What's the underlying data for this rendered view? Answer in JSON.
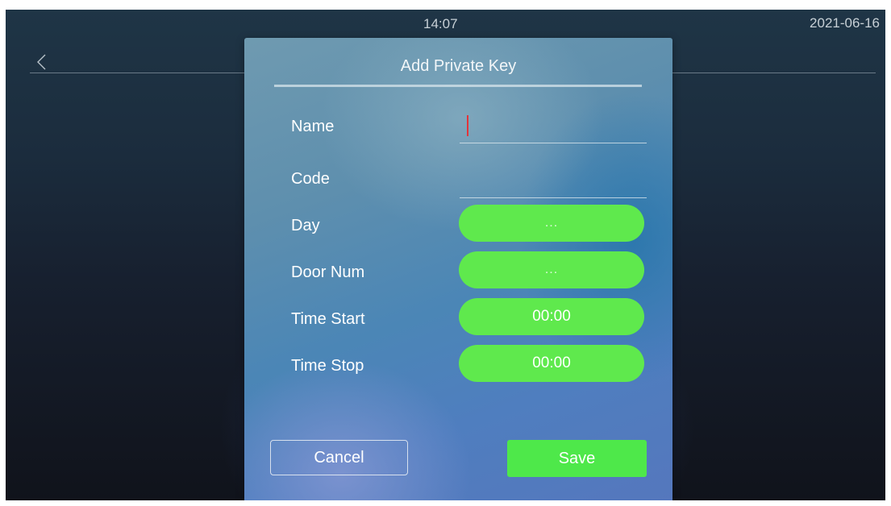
{
  "status_bar": {
    "time": "14:07",
    "date": "2021-06-16"
  },
  "dialog": {
    "title": "Add Private Key",
    "fields": {
      "name": {
        "label": "Name",
        "value": ""
      },
      "code": {
        "label": "Code",
        "value": ""
      },
      "day": {
        "label": "Day",
        "value": "..."
      },
      "door_num": {
        "label": "Door Num",
        "value": "..."
      },
      "time_start": {
        "label": "Time Start",
        "value": "00:00"
      },
      "time_stop": {
        "label": "Time Stop",
        "value": "00:00"
      }
    },
    "buttons": {
      "cancel": "Cancel",
      "save": "Save"
    }
  },
  "colors": {
    "green_button": "#5fe94d",
    "save_button": "#4ee84a",
    "text_cursor": "#e2343a",
    "background": "#141a26"
  },
  "icons": {
    "back": "chevron-left-icon"
  }
}
